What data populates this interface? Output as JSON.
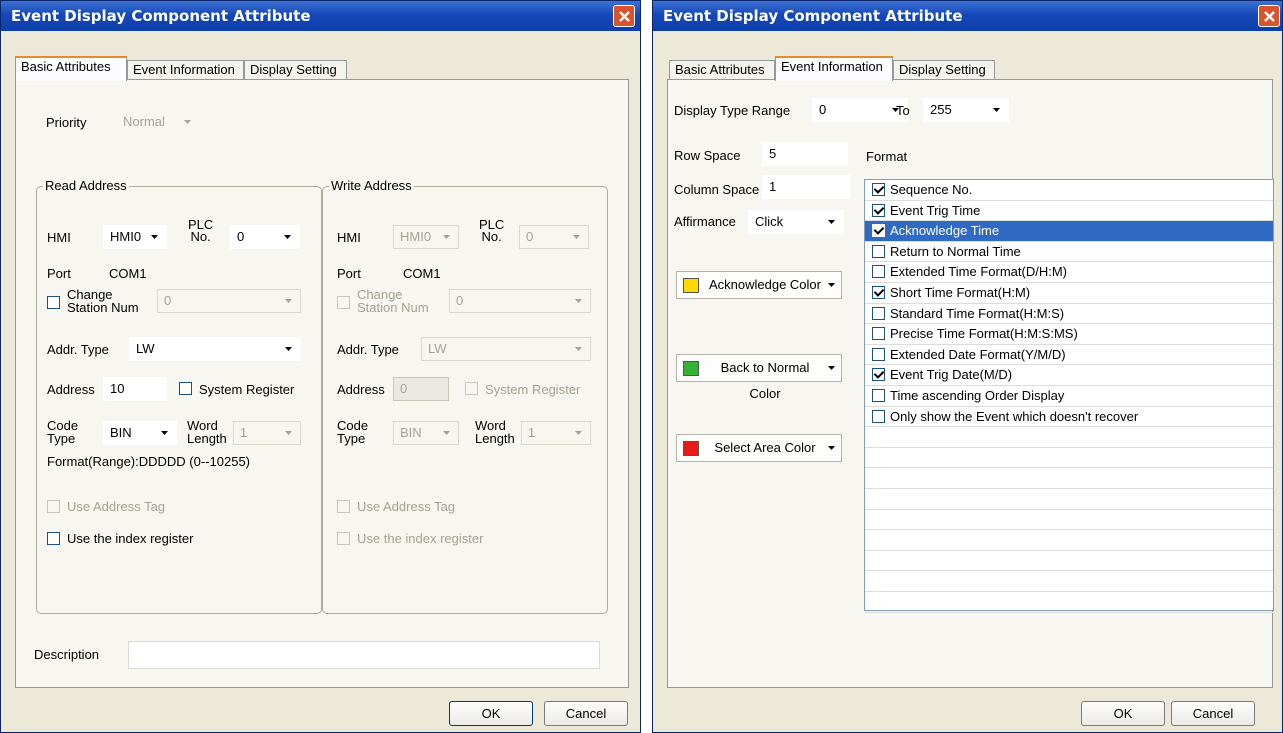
{
  "title": "Event Display Component Attribute",
  "tabs": [
    "Basic Attributes",
    "Event Information",
    "Display Setting"
  ],
  "buttons": {
    "ok": "OK",
    "cancel": "Cancel"
  },
  "basic": {
    "priority_label": "Priority",
    "priority_value": "Normal",
    "read_address": {
      "title": "Read Address",
      "hmi_label": "HMI",
      "hmi_value": "HMI0",
      "plc_label": "PLC\nNo.",
      "plc_value": "0",
      "port_label": "Port",
      "port_value": "COM1",
      "change_station_label": "Change\nStation Num",
      "change_station_value": "0",
      "addr_type_label": "Addr. Type",
      "addr_type_value": "LW",
      "address_label": "Address",
      "address_value": "10",
      "system_register_label": "System Register",
      "code_type_label": "Code\nType",
      "code_type_value": "BIN",
      "word_length_label": "Word\nLength",
      "word_length_value": "1",
      "format_text": "Format(Range):DDDDD (0--10255)",
      "use_address_tag": "Use Address Tag",
      "use_index_register": "Use the index register"
    },
    "write_address": {
      "title": "Write Address",
      "hmi_label": "HMI",
      "hmi_value": "HMI0",
      "plc_label": "PLC\nNo.",
      "plc_value": "0",
      "port_label": "Port",
      "port_value": "COM1",
      "change_station_label": "Change\nStation Num",
      "change_station_value": "0",
      "addr_type_label": "Addr. Type",
      "addr_type_value": "LW",
      "address_label": "Address",
      "address_value": "0",
      "system_register_label": "System Register",
      "code_type_label": "Code\nType",
      "code_type_value": "BIN",
      "word_length_label": "Word\nLength",
      "word_length_value": "1",
      "use_address_tag": "Use Address Tag",
      "use_index_register": "Use the index register"
    },
    "description_label": "Description",
    "description_value": ""
  },
  "event": {
    "display_type_range_label": "Display Type Range",
    "range_from": "0",
    "to_label": "To",
    "range_to": "255",
    "row_space_label": "Row Space",
    "row_space_value": "5",
    "format_label": "Format",
    "column_space_label": "Column Space",
    "column_space_value": "1",
    "affirmance_label": "Affirmance",
    "affirmance_value": "Click",
    "acknowledge_color": {
      "label": "Acknowledge Color",
      "color": "#ffd800"
    },
    "back_to_normal_color": {
      "label": "Back to Normal Color",
      "color": "#33b233"
    },
    "select_area_color": {
      "label": "Select Area Color",
      "color": "#e81a1a"
    },
    "format_items": [
      {
        "label": "Sequence No.",
        "checked": true
      },
      {
        "label": "Event Trig Time",
        "checked": true
      },
      {
        "label": "Acknowledge Time",
        "checked": true
      },
      {
        "label": "Return to Normal Time",
        "checked": false
      },
      {
        "label": "Extended Time Format(D/H:M)",
        "checked": false
      },
      {
        "label": "Short Time Format(H:M)",
        "checked": true
      },
      {
        "label": "Standard Time Format(H:M:S)",
        "checked": false
      },
      {
        "label": "Precise Time Format(H:M:S:MS)",
        "checked": false
      },
      {
        "label": "Extended Date Format(Y/M/D)",
        "checked": false
      },
      {
        "label": "Event Trig Date(M/D)",
        "checked": true
      },
      {
        "label": "Time ascending Order Display",
        "checked": false
      },
      {
        "label": "Only show the Event which doesn't recover",
        "checked": false
      }
    ],
    "selected_item_index": 2
  }
}
